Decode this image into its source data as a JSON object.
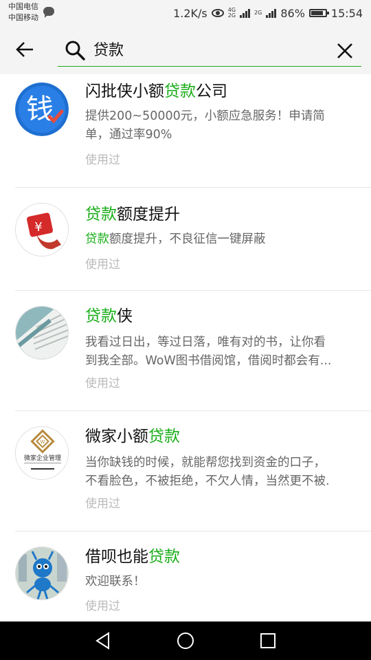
{
  "status_bar": {
    "carrier_1": "中国电信",
    "carrier_2": "中国移动",
    "network_speed": "1.2K/s",
    "net_label_top": "4G",
    "net_label_bottom": "2G",
    "net_label_2": "2G",
    "battery_percent": "86%",
    "battery_level": 0.86,
    "time": "15:54"
  },
  "search": {
    "query": "贷款",
    "accent_color": "#1aad19"
  },
  "results": [
    {
      "title_pre": "闪批侠小额",
      "title_hl": "贷款",
      "title_post": "公司",
      "desc_lines": [
        "提供200~50000元，小额应急服务！申请简",
        "单，通过率90%"
      ],
      "desc_hl": "",
      "used": "使用过",
      "avatar_icon": "qian-character-logo",
      "avatar_text": "钱"
    },
    {
      "title_pre": "",
      "title_hl": "贷款",
      "title_post": "额度提升",
      "desc_lines": [
        "额度提升，不良征信一键屏蔽"
      ],
      "desc_hl": "贷款",
      "used": "使用过",
      "avatar_icon": "yen-hand-logo",
      "avatar_text": "¥"
    },
    {
      "title_pre": "",
      "title_hl": "贷款",
      "title_post": "侠",
      "desc_lines": [
        "我看过日出，等过日落，唯有对的书，让你看",
        "到我全部。WoW图书借阅馆，借阅时都会有..."
      ],
      "desc_hl": "",
      "used": "使用过",
      "avatar_icon": "book-page-photo",
      "avatar_text": ""
    },
    {
      "title_pre": "微家小额",
      "title_hl": "贷款",
      "title_post": "",
      "desc_lines": [
        "当你缺钱的时候，就能帮您找到资金的口子，",
        "不看脸色，不被拒绝，不欠人情，当然更不被."
      ],
      "desc_hl": "",
      "used": "使用过",
      "avatar_icon": "weijia-logo",
      "avatar_text": "微家企业管理"
    },
    {
      "title_pre": "借呗也能",
      "title_hl": "贷款",
      "title_post": "",
      "desc_lines": [
        "欢迎联系！"
      ],
      "desc_hl": "",
      "used": "使用过",
      "avatar_icon": "ant-mascot-logo",
      "avatar_text": ""
    }
  ]
}
